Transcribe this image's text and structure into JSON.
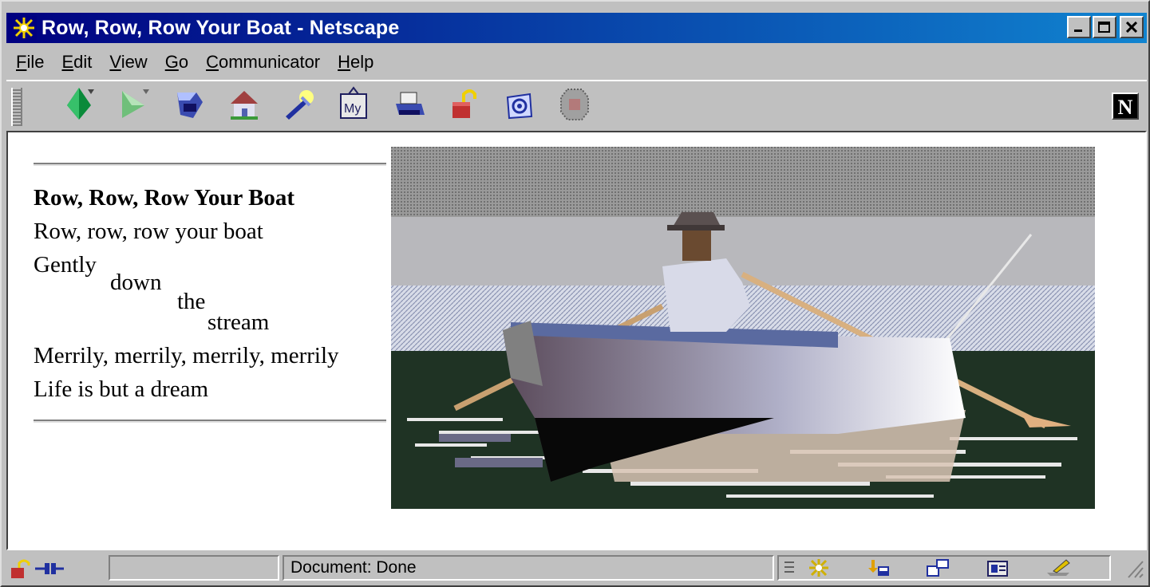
{
  "window": {
    "title": "Row, Row, Row Your Boat - Netscape",
    "minimize_label": "_",
    "maximize_label": "□",
    "close_label": "✕"
  },
  "menu": [
    {
      "label": "File",
      "accel": "F",
      "rest": "ile"
    },
    {
      "label": "Edit",
      "accel": "E",
      "rest": "dit"
    },
    {
      "label": "View",
      "accel": "V",
      "rest": "iew"
    },
    {
      "label": "Go",
      "accel": "G",
      "rest": "o"
    },
    {
      "label": "Communicator",
      "accel": "C",
      "rest": "ommunicator"
    },
    {
      "label": "Help",
      "accel": "H",
      "rest": "elp"
    }
  ],
  "toolbar": {
    "buttons": [
      "back-icon",
      "forward-icon",
      "reload-icon",
      "home-icon",
      "search-icon",
      "my-netscape-icon",
      "print-icon",
      "security-icon",
      "shop-icon",
      "stop-icon"
    ],
    "my_label": "My",
    "netscape_logo": "N"
  },
  "page": {
    "heading": "Row, Row, Row Your Boat",
    "line1": "Row, row, row your boat",
    "line2_words": [
      "Gently",
      "down",
      "the",
      "stream"
    ],
    "line3": "Merrily, merrily, merrily, merrily",
    "line4": "Life is but a dream"
  },
  "status": {
    "text": "Document: Done"
  },
  "colors": {
    "titlebar_start": "#000080",
    "titlebar_end": "#1084d0",
    "chrome": "#c0c0c0",
    "water": "#1f3324"
  }
}
